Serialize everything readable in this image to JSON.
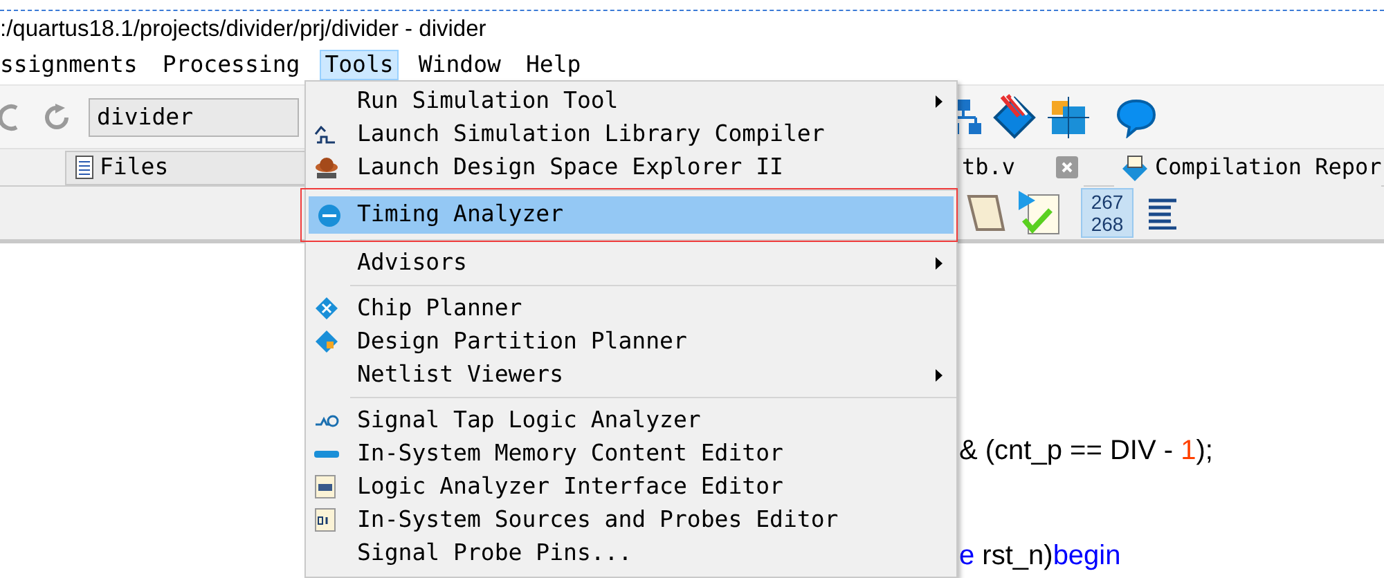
{
  "window": {
    "title": ":/quartus18.1/projects/divider/prj/divider - divider"
  },
  "menubar": [
    {
      "label": "ssignments",
      "selected": false
    },
    {
      "label": "Processing",
      "selected": false
    },
    {
      "label": "Tools",
      "selected": true
    },
    {
      "label": "Window",
      "selected": false
    },
    {
      "label": "Help",
      "selected": false
    }
  ],
  "toolbar": {
    "project_combo": "divider"
  },
  "files_selector": "Files",
  "tabs": [
    {
      "label": "tb.v",
      "closable": true
    },
    {
      "label": "Compilation Repor",
      "closable": false
    }
  ],
  "line_number_toggle": {
    "lines": [
      "267",
      "268"
    ],
    "selected": true
  },
  "tools_menu": [
    {
      "kind": "item",
      "label": "Run Simulation Tool",
      "submenu": true,
      "selected": false,
      "outlined": false
    },
    {
      "kind": "item",
      "label": "Launch Simulation Library Compiler",
      "submenu": false,
      "selected": false,
      "outlined": false
    },
    {
      "kind": "item",
      "label": "Launch Design Space Explorer II",
      "submenu": false,
      "selected": false,
      "outlined": false
    },
    {
      "kind": "separator"
    },
    {
      "kind": "item",
      "label": "Timing Analyzer",
      "submenu": false,
      "selected": true,
      "outlined": true
    },
    {
      "kind": "separator"
    },
    {
      "kind": "item",
      "label": "Advisors",
      "submenu": true,
      "selected": false,
      "outlined": false
    },
    {
      "kind": "separator"
    },
    {
      "kind": "item",
      "label": "Chip Planner",
      "submenu": false,
      "selected": false,
      "outlined": false
    },
    {
      "kind": "item",
      "label": "Design Partition Planner",
      "submenu": false,
      "selected": false,
      "outlined": false
    },
    {
      "kind": "item",
      "label": "Netlist Viewers",
      "submenu": true,
      "selected": false,
      "outlined": false
    },
    {
      "kind": "separator"
    },
    {
      "kind": "item",
      "label": "Signal Tap Logic Analyzer",
      "submenu": false,
      "selected": false,
      "outlined": false
    },
    {
      "kind": "item",
      "label": "In-System Memory Content Editor",
      "submenu": false,
      "selected": false,
      "outlined": false
    },
    {
      "kind": "item",
      "label": "Logic Analyzer Interface Editor",
      "submenu": false,
      "selected": false,
      "outlined": false
    },
    {
      "kind": "item",
      "label": "In-System Sources and Probes Editor",
      "submenu": false,
      "selected": false,
      "outlined": false
    },
    {
      "kind": "item",
      "label": "Signal Probe Pins...",
      "submenu": false,
      "selected": false,
      "outlined": false
    }
  ],
  "code_lines": [
    {
      "tokens": [
        {
          "kind": "plain",
          "text": "& (cnt_p == DIV - "
        },
        {
          "kind": "number",
          "text": "1"
        },
        {
          "kind": "plain",
          "text": ");"
        }
      ]
    },
    {
      "tokens": [
        {
          "kind": "keyword",
          "text": "e"
        },
        {
          "kind": "plain",
          "text": " rst_n)"
        },
        {
          "kind": "keyword",
          "text": "begin"
        }
      ]
    }
  ]
}
